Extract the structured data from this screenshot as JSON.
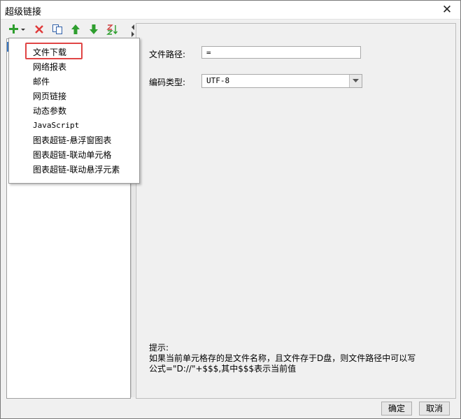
{
  "window": {
    "title": "超级链接",
    "close_glyph": "✕"
  },
  "toolbar": {
    "buttons": [
      {
        "name": "add-menu-button",
        "icon": "plus-icon",
        "color": "#2e9e2e"
      },
      {
        "name": "delete-button",
        "icon": "delete-x-icon",
        "color": "#e03a3a"
      },
      {
        "name": "copy-button",
        "icon": "copy-icon",
        "color": "#2f5fa8"
      },
      {
        "name": "move-up-button",
        "icon": "arrow-up-icon",
        "color": "#2e9e2e"
      },
      {
        "name": "move-down-button",
        "icon": "arrow-down-icon",
        "color": "#2e9e2e"
      },
      {
        "name": "sort-button",
        "icon": "sort-az-icon",
        "color": "#2e9e2e"
      }
    ]
  },
  "menu": {
    "items": [
      "文件下载",
      "网络报表",
      "邮件",
      "网页链接",
      "动态参数",
      "JavaScript",
      "图表超链-悬浮窗图表",
      "图表超链-联动单元格",
      "图表超链-联动悬浮元素"
    ],
    "highlight_color": "#e04545"
  },
  "form": {
    "path_label": "文件路径:",
    "path_value": "=",
    "encoding_label": "编码类型:",
    "encoding_value": "UTF-8"
  },
  "hint": {
    "title": "提示:",
    "line1": "如果当前单元格存的是文件名称，且文件存于D盘，则文件路径中可以写",
    "line2": "公式=\"D://\"+$$$,其中$$$表示当前值"
  },
  "buttons": {
    "ok": "确定",
    "cancel": "取消"
  }
}
